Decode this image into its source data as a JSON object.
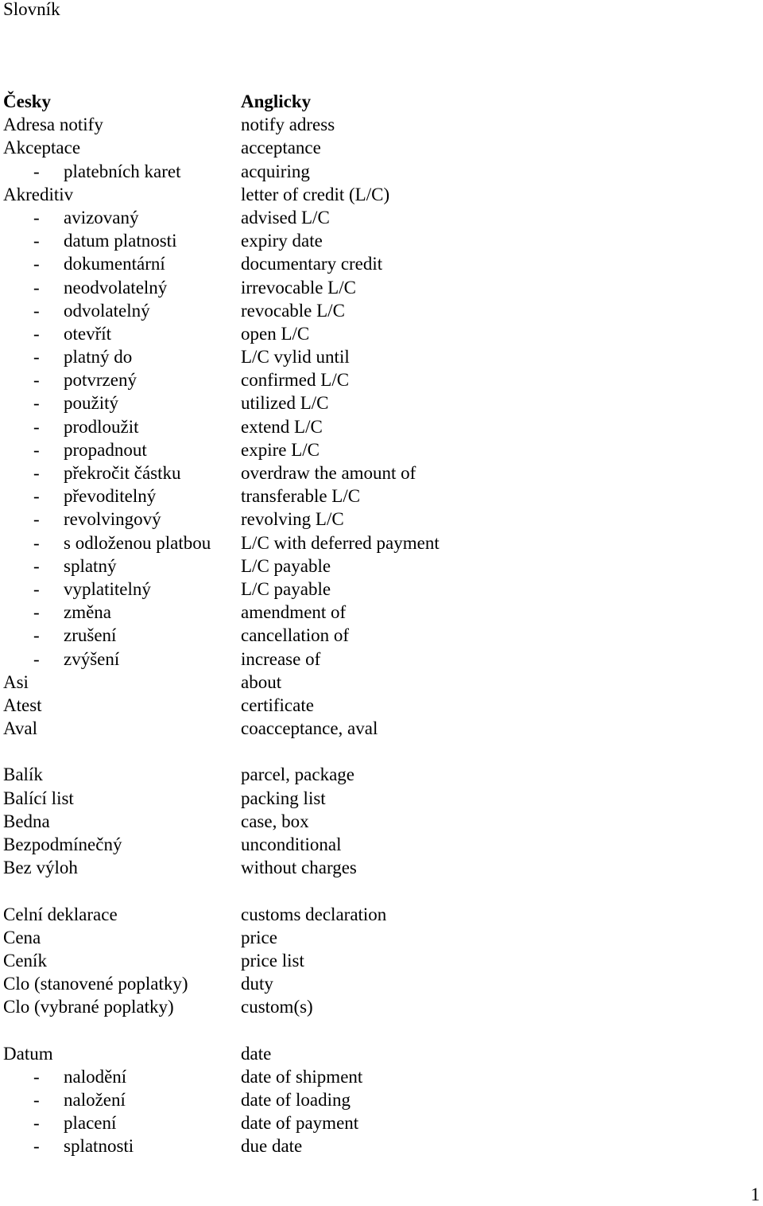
{
  "title": "Slovník",
  "header": {
    "czech": "Česky",
    "english": "Anglicky"
  },
  "entries": [
    {
      "cz": "Adresa notify",
      "en": "notify adress",
      "sub": false
    },
    {
      "cz": "Akceptace",
      "en": "acceptance",
      "sub": false
    },
    {
      "cz": "platebních karet",
      "en": "acquiring",
      "sub": true
    },
    {
      "cz": "Akreditiv",
      "en": "letter of credit (L/C)",
      "sub": false
    },
    {
      "cz": "avizovaný",
      "en": "advised L/C",
      "sub": true
    },
    {
      "cz": "datum platnosti",
      "en": "expiry date",
      "sub": true
    },
    {
      "cz": "dokumentární",
      "en": "documentary credit",
      "sub": true
    },
    {
      "cz": "neodvolatelný",
      "en": "irrevocable L/C",
      "sub": true
    },
    {
      "cz": "odvolatelný",
      "en": "revocable L/C",
      "sub": true
    },
    {
      "cz": "otevřít",
      "en": "open L/C",
      "sub": true
    },
    {
      "cz": "platný do",
      "en": "L/C vylid until",
      "sub": true
    },
    {
      "cz": "potvrzený",
      "en": "confirmed L/C",
      "sub": true
    },
    {
      "cz": "použitý",
      "en": "utilized L/C",
      "sub": true
    },
    {
      "cz": "prodloužit",
      "en": "extend L/C",
      "sub": true
    },
    {
      "cz": "propadnout",
      "en": "expire L/C",
      "sub": true
    },
    {
      "cz": "překročit částku",
      "en": "overdraw the amount of",
      "sub": true
    },
    {
      "cz": "převoditelný",
      "en": "transferable L/C",
      "sub": true
    },
    {
      "cz": "revolvingový",
      "en": "revolving L/C",
      "sub": true
    },
    {
      "cz": "s odloženou platbou",
      "en": "L/C with deferred payment",
      "sub": true
    },
    {
      "cz": "splatný",
      "en": "L/C payable",
      "sub": true
    },
    {
      "cz": "vyplatitelný",
      "en": "L/C payable",
      "sub": true
    },
    {
      "cz": "změna",
      "en": "amendment of",
      "sub": true
    },
    {
      "cz": "zrušení",
      "en": "cancellation of",
      "sub": true
    },
    {
      "cz": "zvýšení",
      "en": "increase of",
      "sub": true
    },
    {
      "cz": "Asi",
      "en": "about",
      "sub": false
    },
    {
      "cz": "Atest",
      "en": "certificate",
      "sub": false
    },
    {
      "cz": "Aval",
      "en": "coacceptance, aval",
      "sub": false
    },
    {
      "blank": true
    },
    {
      "cz": "Balík",
      "en": "parcel, package",
      "sub": false
    },
    {
      "cz": "Balící list",
      "en": "packing list",
      "sub": false
    },
    {
      "cz": "Bedna",
      "en": "case, box",
      "sub": false
    },
    {
      "cz": "Bezpodmínečný",
      "en": "unconditional",
      "sub": false
    },
    {
      "cz": "Bez výloh",
      "en": "without charges",
      "sub": false
    },
    {
      "blank": true
    },
    {
      "cz": "Celní deklarace",
      "en": "customs declaration",
      "sub": false
    },
    {
      "cz": "Cena",
      "en": "price",
      "sub": false
    },
    {
      "cz": "Ceník",
      "en": "price list",
      "sub": false
    },
    {
      "cz": "Clo (stanovené poplatky)",
      "en": "duty",
      "sub": false
    },
    {
      "cz": "Clo (vybrané poplatky)",
      "en": "custom(s)",
      "sub": false
    },
    {
      "blank": true
    },
    {
      "cz": "Datum",
      "en": "date",
      "sub": false
    },
    {
      "cz": "nalodění",
      "en": "date of shipment",
      "sub": true
    },
    {
      "cz": "naložení",
      "en": "date of loading",
      "sub": true
    },
    {
      "cz": "placení",
      "en": "date of payment",
      "sub": true
    },
    {
      "cz": "splatnosti",
      "en": "due date",
      "sub": true
    }
  ],
  "sub_marker": "-",
  "page_number": "1"
}
